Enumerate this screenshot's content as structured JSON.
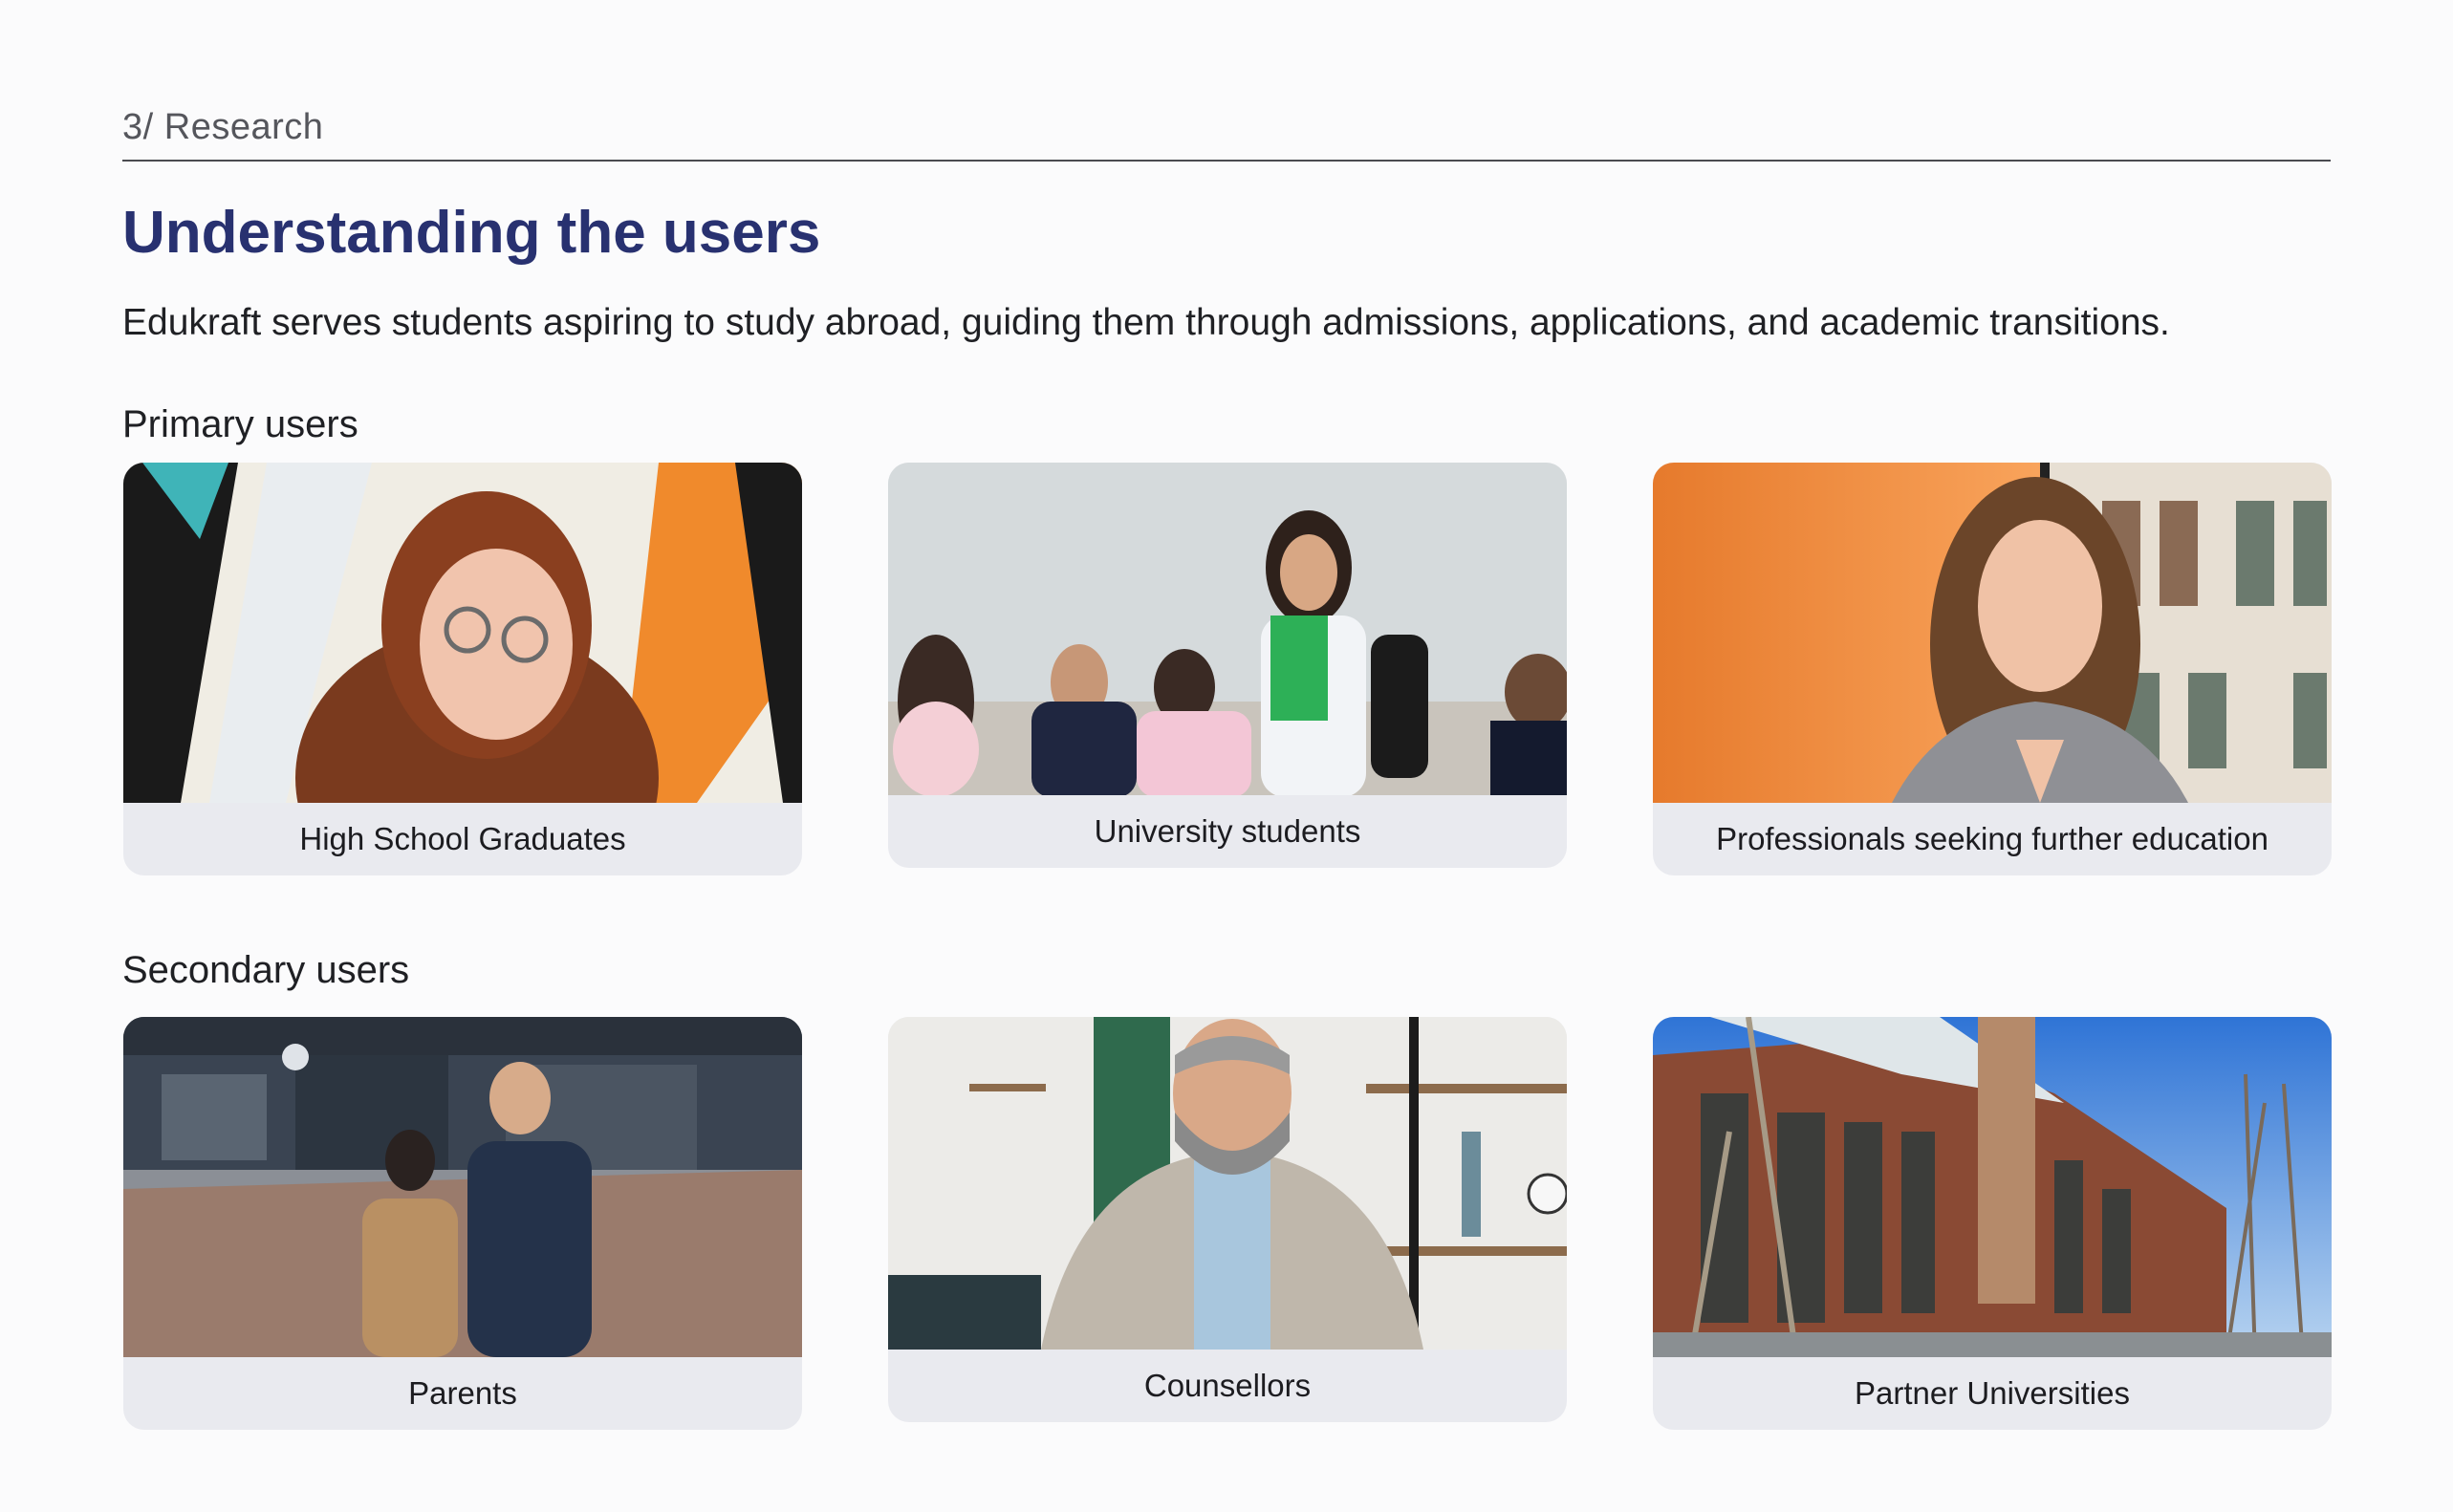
{
  "section": {
    "eyebrow": "3/ Research",
    "title": "Understanding the users",
    "description": "Edukraft serves students aspiring to study abroad, guiding them through admissions, applications, and academic transitions."
  },
  "primary": {
    "label": "Primary users",
    "cards": [
      {
        "caption": "High School Graduates",
        "image": "portrait-young-woman-glasses-graffiti"
      },
      {
        "caption": "University students",
        "image": "students-in-classroom"
      },
      {
        "caption": "Professionals seeking further education",
        "image": "smiling-woman-orange-wall"
      }
    ]
  },
  "secondary": {
    "label": "Secondary users",
    "cards": [
      {
        "caption": "Parents",
        "image": "couple-on-city-street"
      },
      {
        "caption": "Counsellors",
        "image": "bearded-man-in-office"
      },
      {
        "caption": "Partner Universities",
        "image": "university-building"
      }
    ]
  },
  "colors": {
    "title": "#283170",
    "card_background": "#e9eaef",
    "page_background": "#fbfbfc"
  }
}
